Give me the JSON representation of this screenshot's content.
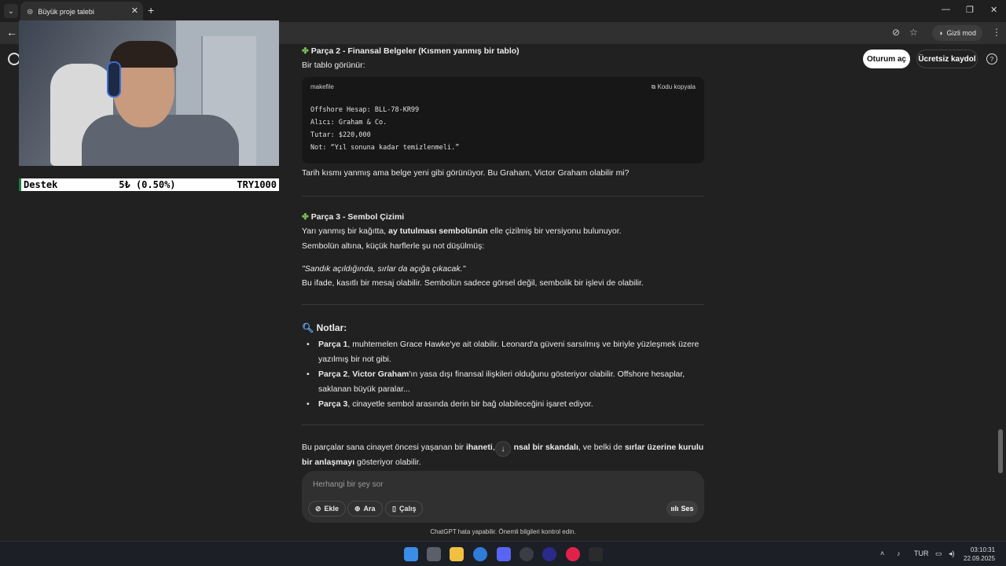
{
  "browser": {
    "tab_title": "Büyük proje talebi",
    "incognito_label": "Gizli mod"
  },
  "header": {
    "login_label": "Oturum aç",
    "signup_label": "Ücretsiz kaydol",
    "help_label": "?"
  },
  "chat": {
    "part2_title": "Parça 2 - Finansal Belgeler (Kısmen yanmış bir tablo)",
    "part2_intro": "Bir tablo görünür:",
    "code_lang": "makefile",
    "copy_label": "Kodu kopyala",
    "code_lines": "Offshore Hesap: BLL-78-KR99\nAlıcı: Graham & Co.\nTutar: $220,000\nNot: “Yıl sonuna kadar temizlenmeli.”",
    "part2_after": "Tarih kısmı yanmış ama belge yeni gibi görünüyor. Bu Graham, Victor Graham olabilir mi?",
    "part3_title": "Parça 3 - Sembol Çizimi",
    "part3_line1_a": "Yarı yanmış bir kağıtta, ",
    "part3_line1_b": "ay tutulması sembolünün",
    "part3_line1_c": " elle çizilmiş bir versiyonu bulunuyor.",
    "part3_line2": "Sembolün altına, küçük harflerle şu not düşülmüş:",
    "part3_quote": "\"Sandık açıldığında, sırlar da açığa çıkacak.\"",
    "part3_after": "Bu ifade, kasıtlı bir mesaj olabilir. Sembolün sadece görsel değil, sembolik bir işlevi de olabilir.",
    "notes_title": "Notlar:",
    "note1_b": "Parça 1",
    "note1_t": ", muhtemelen Grace Hawke'ye ait olabilir. Leonard'a güveni sarsılmış ve biriyle yüzleşmek üzere yazılmış bir not gibi.",
    "note2_b1": "Parça 2",
    "note2_sep": ", ",
    "note2_b2": "Victor Graham",
    "note2_t": "'ın yasa dışı finansal ilişkileri olduğunu gösteriyor olabilir. Offshore hesaplar, saklanan büyük paralar...",
    "note3_b": "Parça 3",
    "note3_t": ", cinayetle sembol arasında derin bir bağ olabileceğini işaret ediyor.",
    "summary_a": "Bu parçalar sana cinayet öncesi yaşanan bir ",
    "summary_b1": "ihaneti",
    "summary_c": ", f",
    "summary_b2": "nsal bir skandalı",
    "summary_d": ", ve belki de ",
    "summary_b3": "sırlar üzerine kurulu bir anlaşmayı",
    "summary_e": " gösteriyor olabilir."
  },
  "composer": {
    "placeholder": "Herhangi bir şey sor",
    "add_label": "Ekle",
    "search_label": "Ara",
    "study_label": "Çalış",
    "voice_label": "Ses",
    "disclaimer": "ChatGPT hata yapabilir. Önemli bilgileri kontrol edin."
  },
  "overlay": {
    "donate_label": "Destek",
    "donate_amount": "5₺ (0.50%)",
    "donate_goal": "TRY1000"
  },
  "taskbar": {
    "lang": "TUR",
    "time": "03:10:31",
    "date": "22.09.2025"
  },
  "colors": {
    "page_bg": "#212121",
    "composer_bg": "#303030",
    "code_bg": "#171717",
    "donate_accent": "#1c7c3c"
  }
}
